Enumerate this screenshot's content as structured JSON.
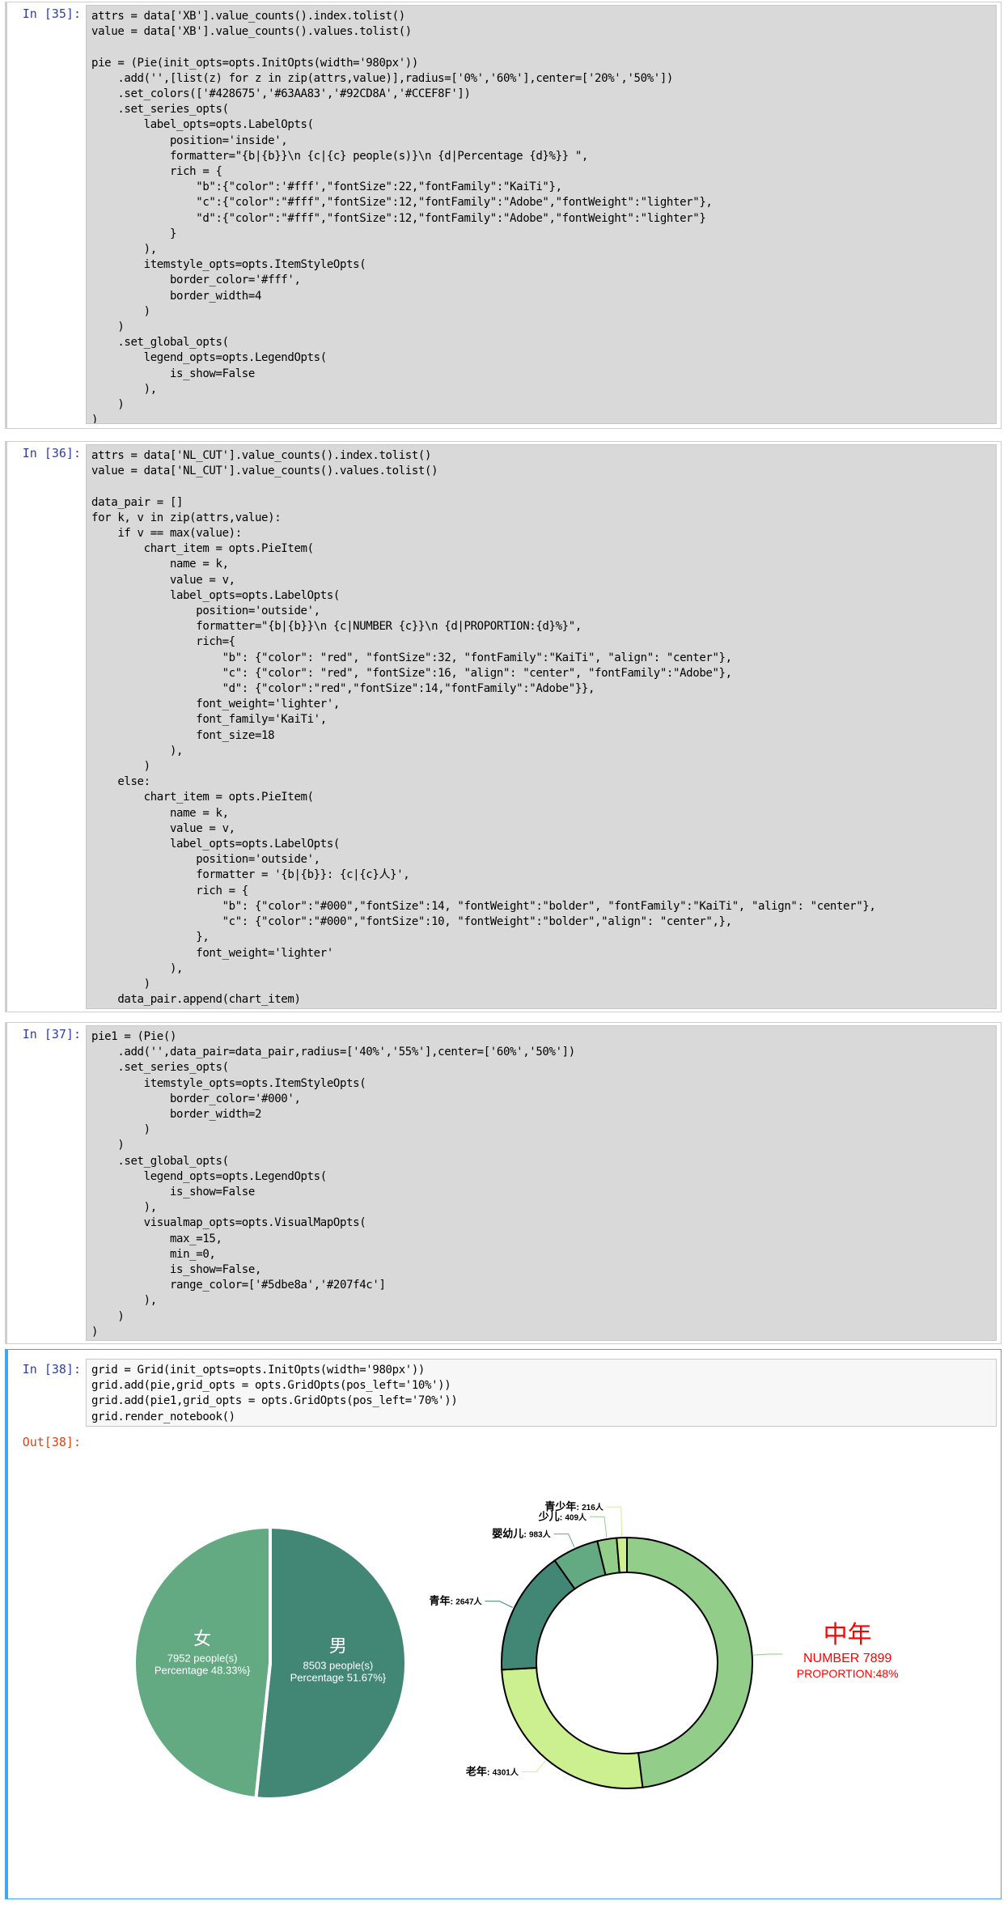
{
  "cells": {
    "c35": {
      "prompt": "In [35]:",
      "code": "attrs = data['XB'].value_counts().index.tolist()\nvalue = data['XB'].value_counts().values.tolist()\n\npie = (Pie(init_opts=opts.InitOpts(width='980px'))\n    .add('',[list(z) for z in zip(attrs,value)],radius=['0%','60%'],center=['20%','50%'])\n    .set_colors(['#428675','#63AA83','#92CD8A','#CCEF8F'])\n    .set_series_opts(\n        label_opts=opts.LabelOpts(\n            position='inside',\n            formatter=\"{b|{b}}\\n {c|{c} people(s)}\\n {d|Percentage {d}%}} \",\n            rich = {\n                \"b\":{\"color\":'#fff',\"fontSize\":22,\"fontFamily\":\"KaiTi\"},\n                \"c\":{\"color\":\"#fff\",\"fontSize\":12,\"fontFamily\":\"Adobe\",\"fontWeight\":\"lighter\"},\n                \"d\":{\"color\":\"#fff\",\"fontSize\":12,\"fontFamily\":\"Adobe\",\"fontWeight\":\"lighter\"}\n            }\n        ),\n        itemstyle_opts=opts.ItemStyleOpts(\n            border_color='#fff',\n            border_width=4\n        )\n    )\n    .set_global_opts(\n        legend_opts=opts.LegendOpts(\n            is_show=False\n        ),\n    )\n)"
    },
    "c36": {
      "prompt": "In [36]:",
      "code": "attrs = data['NL_CUT'].value_counts().index.tolist()\nvalue = data['NL_CUT'].value_counts().values.tolist()\n\ndata_pair = []\nfor k, v in zip(attrs,value):\n    if v == max(value):\n        chart_item = opts.PieItem(\n            name = k,\n            value = v,\n            label_opts=opts.LabelOpts(\n                position='outside',\n                formatter=\"{b|{b}}\\n {c|NUMBER {c}}\\n {d|PROPORTION:{d}%}\",\n                rich={\n                    \"b\": {\"color\": \"red\", \"fontSize\":32, \"fontFamily\":\"KaiTi\", \"align\": \"center\"},\n                    \"c\": {\"color\": \"red\", \"fontSize\":16, \"align\": \"center\", \"fontFamily\":\"Adobe\"},\n                    \"d\": {\"color\":\"red\",\"fontSize\":14,\"fontFamily\":\"Adobe\"}},\n                font_weight='lighter',\n                font_family='KaiTi',\n                font_size=18\n            ),\n        )\n    else:\n        chart_item = opts.PieItem(\n            name = k,\n            value = v,\n            label_opts=opts.LabelOpts(\n                position='outside',\n                formatter = '{b|{b}}: {c|{c}人}',\n                rich = {\n                    \"b\": {\"color\":\"#000\",\"fontSize\":14, \"fontWeight\":\"bolder\", \"fontFamily\":\"KaiTi\", \"align\": \"center\"},\n                    \"c\": {\"color\":\"#000\",\"fontSize\":10, \"fontWeight\":\"bolder\",\"align\": \"center\",},\n                },\n                font_weight='lighter'\n            ),\n        )\n    data_pair.append(chart_item)"
    },
    "c37": {
      "prompt": "In [37]:",
      "code": "pie1 = (Pie()\n    .add('',data_pair=data_pair,radius=['40%','55%'],center=['60%','50%'])\n    .set_series_opts(\n        itemstyle_opts=opts.ItemStyleOpts(\n            border_color='#000',\n            border_width=2\n        )\n    )\n    .set_global_opts(\n        legend_opts=opts.LegendOpts(\n            is_show=False\n        ),\n        visualmap_opts=opts.VisualMapOpts(\n            max_=15,\n            min_=0,\n            is_show=False,\n            range_color=['#5dbe8a','#207f4c']\n        ),\n    )\n)"
    },
    "c38": {
      "prompt": "In [38]:",
      "out_prompt": "Out[38]:",
      "code": "grid = Grid(init_opts=opts.InitOpts(width='980px'))\ngrid.add(pie,grid_opts = opts.GridOpts(pos_left='10%'))\ngrid.add(pie1,grid_opts = opts.GridOpts(pos_left='70%'))\ngrid.render_notebook()"
    }
  },
  "chart_data": [
    {
      "type": "pie",
      "slices": [
        {
          "name": "男",
          "value": 8503,
          "percent": 51.67,
          "people_label": "8503 people(s)",
          "percent_label": "Percentage 51.67%}",
          "color": "#428675"
        },
        {
          "name": "女",
          "value": 7952,
          "percent": 48.33,
          "people_label": "7952 people(s)",
          "percent_label": "Percentage 48.33%}",
          "color": "#63AA83"
        }
      ]
    },
    {
      "type": "pie",
      "subtype": "donut",
      "slices": [
        {
          "name": "中年",
          "value": 7899,
          "color": "#92CD8A",
          "number_label": "NUMBER 7899",
          "proportion_label": "PROPORTION:48%"
        },
        {
          "name": "老年",
          "value": 4301,
          "color": "#CCEF8F",
          "count_label": "4301人"
        },
        {
          "name": "青年",
          "value": 2647,
          "color": "#428675",
          "count_label": "2647人"
        },
        {
          "name": "婴幼儿",
          "value": 983,
          "color": "#63AA83",
          "count_label": "983人"
        },
        {
          "name": "少儿",
          "value": 409,
          "color": "#92CD8A",
          "count_label": "409人"
        },
        {
          "name": "青少年",
          "value": 216,
          "color": "#CCEF8F",
          "count_label": "216人"
        }
      ],
      "highlight_color": "#ff0000"
    }
  ]
}
